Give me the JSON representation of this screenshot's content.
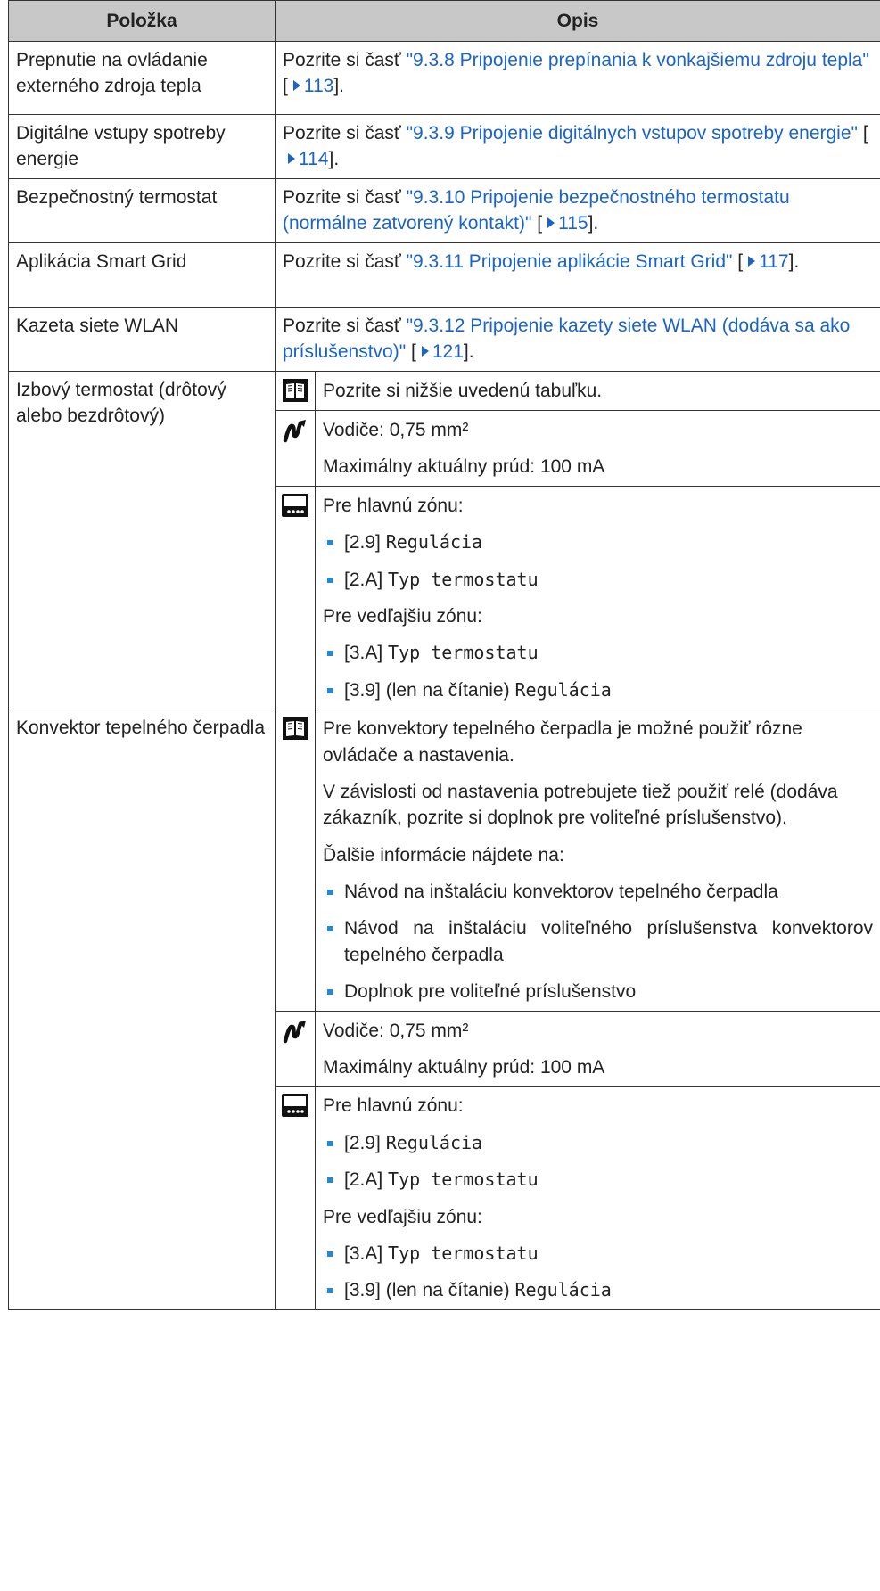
{
  "header": {
    "col1": "Položka",
    "col2": "Opis"
  },
  "rows": [
    {
      "item": "Prepnutie na ovládanie externého zdroja tepla",
      "pre": "Pozrite si časť ",
      "link": "\"9.3.8 Pripojenie prepínania k vonkajšiemu zdroju tepla\"",
      "mid": " [",
      "page": "113",
      "post": "]."
    },
    {
      "item": "Digitálne vstupy spotreby energie",
      "pre": "Pozrite si časť ",
      "link": "\"9.3.9 Pripojenie digitálnych vstupov spotreby energie\"",
      "mid": " [",
      "page": "114",
      "post": "]."
    },
    {
      "item": "Bezpečnostný termostat",
      "pre": "Pozrite si časť ",
      "link": "\"9.3.10 Pripojenie bezpečnostného termostatu (normálne zatvorený kontakt)\"",
      "mid": " [",
      "page": "115",
      "post": "]."
    },
    {
      "item": "Aplikácia Smart Grid",
      "pre": "Pozrite si časť ",
      "link": "\"9.3.11 Pripojenie aplikácie Smart Grid\"",
      "mid": " [",
      "page": "117",
      "post": "]."
    },
    {
      "item": "Kazeta siete WLAN",
      "pre": "Pozrite si časť ",
      "link": "\"9.3.12 Pripojenie kazety siete WLAN (dodáva sa ako príslušenstvo)\"",
      "mid": " [",
      "page": "121",
      "post": "]."
    }
  ],
  "thermostat": {
    "item": "Izbový termostat (drôtový alebo bezdrôtový)",
    "book_text": "Pozrite si nižšie uvedenú tabuľku.",
    "wire": {
      "line1": "Vodiče: 0,75 mm²",
      "line2": "Maximálny aktuálny prúd: 100 mA"
    },
    "settings": {
      "main_zone": "Pre hlavnú zónu:",
      "m1_code": "[2.9]",
      "m1_name": "Regulácia",
      "m2_code": "[2.A]",
      "m2_name": "Typ termostatu",
      "aux_zone": "Pre vedľajšiu zónu:",
      "a1_code": "[3.A]",
      "a1_name": "Typ termostatu",
      "a2_code": "[3.9] (len na čítanie)",
      "a2_name": "Regulácia"
    }
  },
  "convector": {
    "item": "Konvektor tepelného čerpadla",
    "p1": "Pre konvektory tepelného čerpadla je možné použiť rôzne ovládače a nastavenia.",
    "p2": "V závislosti od nastavenia potrebujete tiež použiť relé (dodáva zákazník, pozrite si doplnok pre voliteľné príslušenstvo).",
    "p3": "Ďalšie informácie nájdete na:",
    "b1": "Návod na inštaláciu konvektorov tepelného čerpadla",
    "b2": "Návod na inštaláciu voliteľného príslušenstva konvektorov tepelného čerpadla",
    "b3": "Doplnok pre voliteľné príslušenstvo",
    "wire": {
      "line1": "Vodiče: 0,75 mm²",
      "line2": "Maximálny aktuálny prúd: 100 mA"
    },
    "settings": {
      "main_zone": "Pre hlavnú zónu:",
      "m1_code": "[2.9]",
      "m1_name": "Regulácia",
      "m2_code": "[2.A]",
      "m2_name": "Typ termostatu",
      "aux_zone": "Pre vedľajšiu zónu:",
      "a1_code": "[3.A]",
      "a1_name": "Typ termostatu",
      "a2_code": "[3.9] (len na čítanie)",
      "a2_name": "Regulácia"
    }
  },
  "icons": {
    "book": "book-icon",
    "wire": "wire-icon",
    "ui": "user-interface-icon"
  },
  "colors": {
    "link": "#1a64c8",
    "header_bg": "#c8c8c8",
    "bullet": "#1a8be0"
  }
}
